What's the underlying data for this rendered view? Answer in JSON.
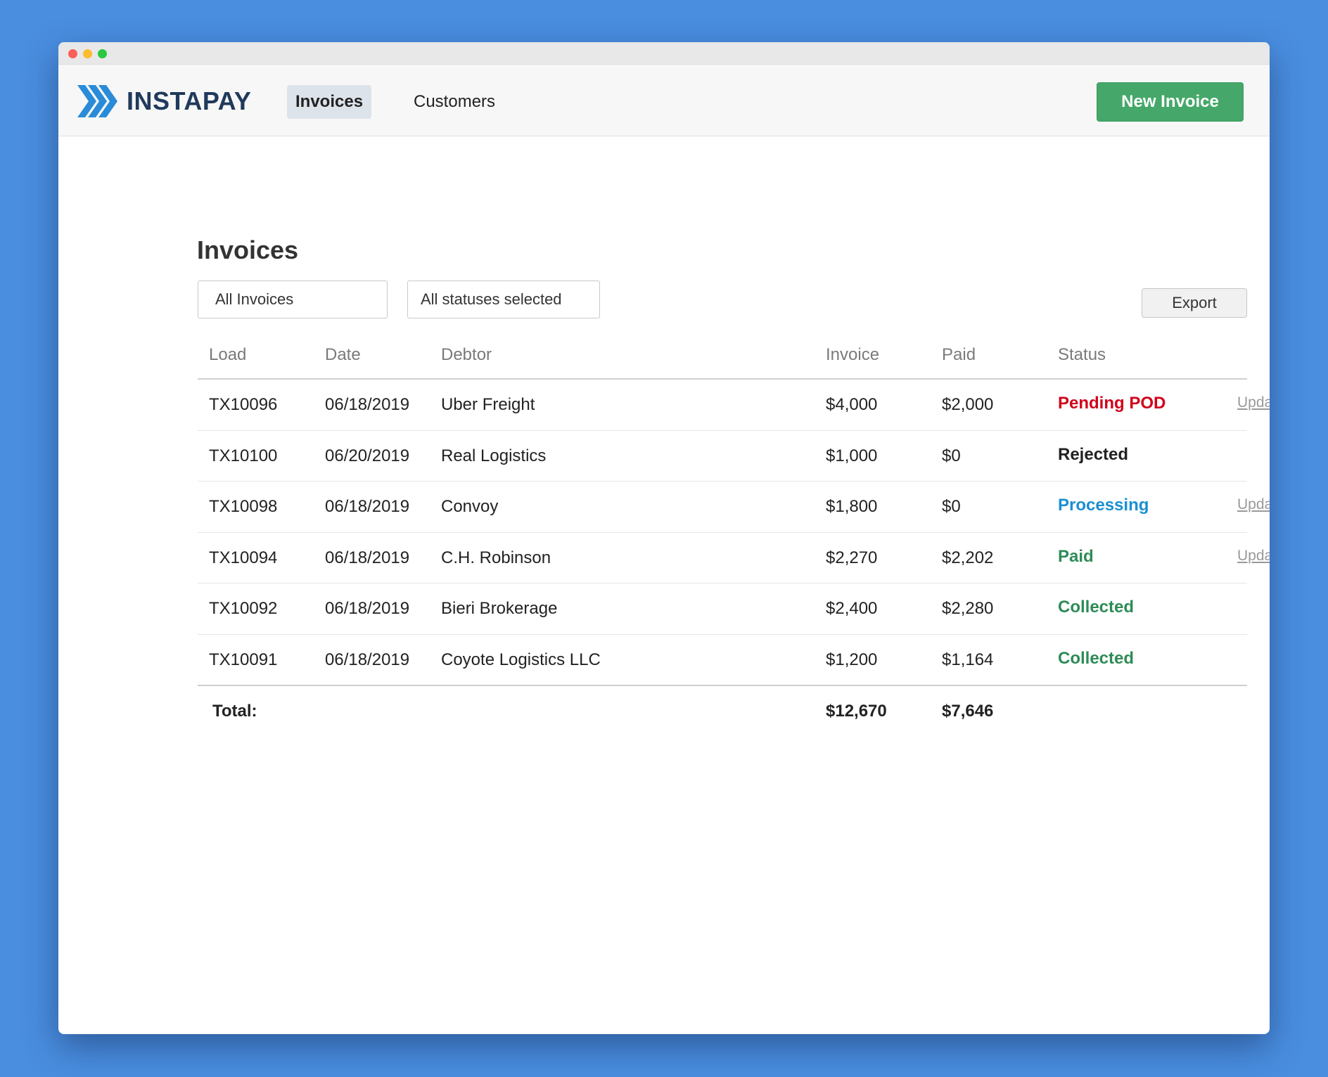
{
  "app": {
    "logo_text": "INSTAPAY"
  },
  "nav": {
    "tabs": [
      {
        "label": "Invoices",
        "active": true
      },
      {
        "label": "Customers",
        "active": false
      }
    ],
    "new_invoice_label": "New Invoice"
  },
  "page": {
    "title": "Invoices",
    "filter_invoices": "All Invoices",
    "filter_statuses": "All statuses selected",
    "export_label": "Export"
  },
  "table": {
    "columns": {
      "load": "Load",
      "date": "Date",
      "debtor": "Debtor",
      "invoice": "Invoice",
      "paid": "Paid",
      "status": "Status"
    },
    "rows": [
      {
        "load": "TX10096",
        "date": "06/18/2019",
        "debtor": "Uber Freight",
        "invoice": "$4,000",
        "paid": "$2,000",
        "status": "Pending POD",
        "status_color": "#d0021b",
        "action": "Update"
      },
      {
        "load": "TX10100",
        "date": "06/20/2019",
        "debtor": "Real Logistics",
        "invoice": "$1,000",
        "paid": "$0",
        "status": "Rejected",
        "status_color": "#222222",
        "action": ""
      },
      {
        "load": "TX10098",
        "date": "06/18/2019",
        "debtor": "Convoy",
        "invoice": "$1,800",
        "paid": "$0",
        "status": "Processing",
        "status_color": "#1a8fd0",
        "action": "Update"
      },
      {
        "load": "TX10094",
        "date": "06/18/2019",
        "debtor": "C.H. Robinson",
        "invoice": "$2,270",
        "paid": "$2,202",
        "status": "Paid",
        "status_color": "#2e8b57",
        "action": "Update"
      },
      {
        "load": "TX10092",
        "date": "06/18/2019",
        "debtor": "Bieri Brokerage",
        "invoice": "$2,400",
        "paid": "$2,280",
        "status": "Collected",
        "status_color": "#2e8b57",
        "action": ""
      },
      {
        "load": "TX10091",
        "date": "06/18/2019",
        "debtor": "Coyote Logistics LLC",
        "invoice": "$1,200",
        "paid": "$1,164",
        "status": "Collected",
        "status_color": "#2e8b57",
        "action": ""
      }
    ],
    "total": {
      "label": "Total:",
      "invoice": "$12,670",
      "paid": "$7,646"
    }
  },
  "colors": {
    "background": "#4a8ee0",
    "primary_button": "#45a86a",
    "brand_text": "#1f3a5c",
    "brand_mark": "#2a8bd8"
  }
}
